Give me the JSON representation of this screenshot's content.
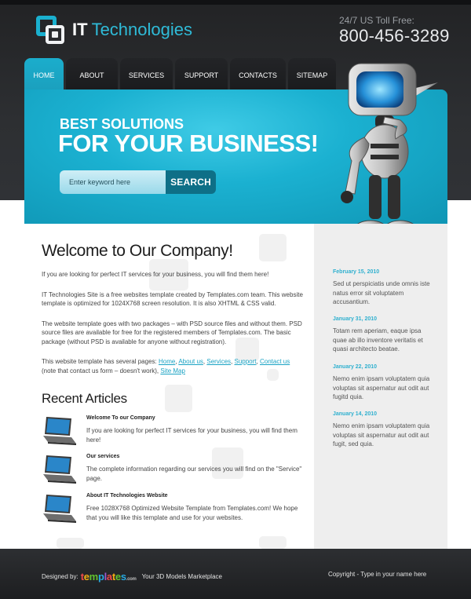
{
  "brand": {
    "name": "IT",
    "name_accent": "Technologies"
  },
  "phone": {
    "label": "24/7 US Toll Free:",
    "number": "800-456-3289"
  },
  "nav": [
    "HOME",
    "ABOUT",
    "SERVICES",
    "SUPPORT",
    "CONTACTS",
    "SITEMAP"
  ],
  "hero": {
    "line1": "BEST SOLUTIONS",
    "line2": "FOR YOUR BUSINESS!",
    "search_placeholder": "Enter keyword here",
    "search_button": "SEARCH"
  },
  "main": {
    "title": "Welcome to Our Company!",
    "p1": "If you are looking for perfect IT services for your business, you will find them here!",
    "p2": "IT Technologies Site is a free websites template created by Templates.com team. This website template is optimized for 1024X768 screen resolution. It is also XHTML & CSS valid.",
    "p3": "The website template goes with two packages – with PSD source files and without them. PSD source files are available for free for the registered members of Templates.com. The basic package (without PSD is available for anyone without registration).",
    "p4_prefix": "This website template has several pages: ",
    "p4_links": [
      "Home",
      "About us",
      "Services",
      "Support",
      "Contact us"
    ],
    "p4_middle": " (note that contact us form – doesn't work), ",
    "p4_last_link": "Site Map",
    "recent_title": "Recent Articles",
    "articles": [
      {
        "title": "Welcome To our Company",
        "text": "If you are looking for perfect IT services for your business, you will find them here!"
      },
      {
        "title": "Our services",
        "text": "The complete information regarding our services you will find on the \"Service\" page."
      },
      {
        "title": "About IT Technologies Website",
        "text": "Free 1028X768 Optimized Website Template from Templates.com! We hope that you will like this template and use for your websites."
      }
    ]
  },
  "sidebar": {
    "news": [
      {
        "date": "February 15, 2010",
        "text": "Sed ut perspiciatis unde omnis iste natus error sit voluptatem accusantium."
      },
      {
        "date": "January 31, 2010",
        "text": "Totam rem aperiam, eaque ipsa quae ab illo inventore veritatis et quasi architecto beatae."
      },
      {
        "date": "January 22, 2010",
        "text": "Nemo enim ipsam voluptatem quia voluptas sit aspernatur aut odit aut fugitd quia."
      },
      {
        "date": "January 14, 2010",
        "text": "Nemo enim ipsam voluptatem quia voluptas sit aspernatur aut odit aut fugit, sed quia."
      }
    ]
  },
  "footer": {
    "designed_by": "Designed by:",
    "brand_letters": [
      "t",
      "e",
      "m",
      "p",
      "l",
      "a",
      "t",
      "e",
      "s"
    ],
    "brand_suffix": ".com",
    "tagline": "Your 3D Models Marketplace",
    "copyright": "Copyright - Type in your name here"
  },
  "colors": {
    "accent": "#1bb1d1",
    "dark": "#2d2f32",
    "sidebar": "#eeeeee"
  }
}
